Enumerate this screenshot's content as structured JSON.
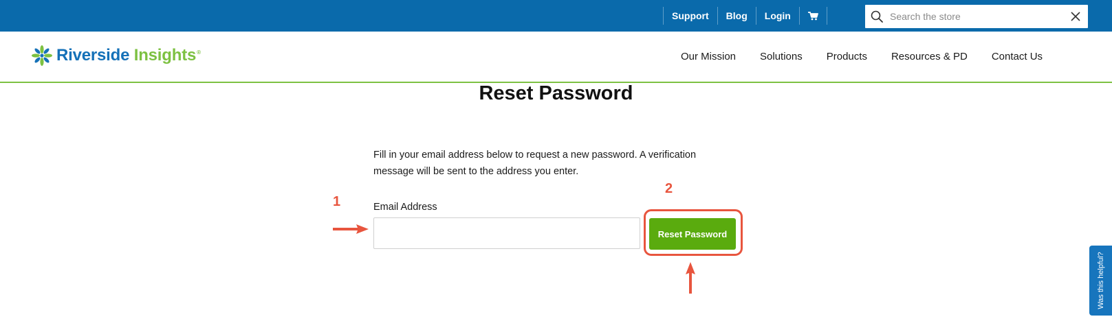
{
  "topbar": {
    "links": [
      "Support",
      "Blog",
      "Login"
    ],
    "cart_icon": "cart-icon",
    "search": {
      "placeholder": "Search the store",
      "value": "",
      "icon": "search-icon",
      "clear_icon": "close-icon"
    }
  },
  "header": {
    "logo": {
      "brand_part1": "Riverside",
      "brand_part2": "Insights",
      "registered": "®"
    },
    "nav": [
      "Our Mission",
      "Solutions",
      "Products",
      "Resources & PD",
      "Contact Us"
    ]
  },
  "page": {
    "title": "Reset Password",
    "description_line1": "Fill in your email address below to request a new password. A verification",
    "description_line2": "message will be sent to the address you enter.",
    "email_label": "Email Address",
    "email_value": "",
    "submit_label": "Reset Password"
  },
  "annotations": {
    "marker1": "1",
    "marker2": "2",
    "color": "#e8553e"
  },
  "feedback_tab": {
    "label": "Was this helpful?"
  },
  "colors": {
    "topbar": "#0a6aab",
    "brand_blue": "#1571b8",
    "brand_green": "#7dc142",
    "button": "#5aab0e"
  }
}
